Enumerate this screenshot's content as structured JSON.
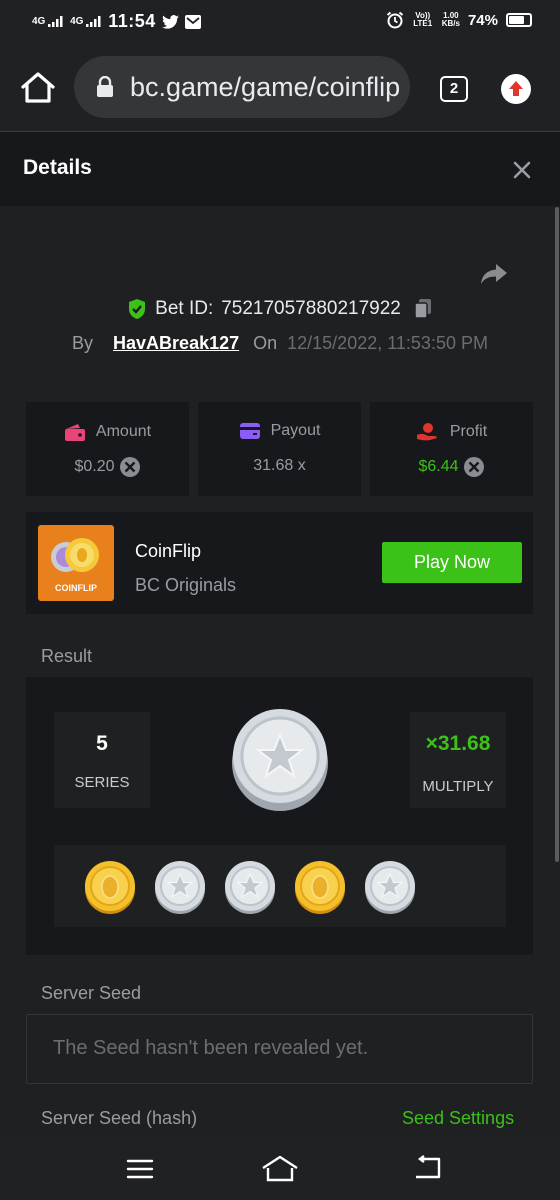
{
  "status_bar": {
    "signal1": "4G",
    "signal2": "4G",
    "time": "11:54",
    "volte": "Vo)) LTE1",
    "speed": "1.00",
    "speed_unit": "KB/s",
    "battery": "74%"
  },
  "browser": {
    "url": "bc.game/game/coinflip",
    "tab_count": "2"
  },
  "details": {
    "title": "Details"
  },
  "bet": {
    "bet_id_label": "Bet ID:",
    "bet_id": "75217057880217922",
    "by_label": "By",
    "username": "HavABreak127",
    "on_label": "On",
    "datetime": "12/15/2022, 11:53:50 PM"
  },
  "stats": [
    {
      "label": "Amount",
      "value": "$0.20",
      "icon": "wallet-icon",
      "color": "#e8447a"
    },
    {
      "label": "Payout",
      "value": "31.68 x",
      "icon": "card-icon",
      "color": "#8b5cf6"
    },
    {
      "label": "Profit",
      "value": "$6.44",
      "icon": "hand-coin-icon",
      "color": "#e0342f"
    }
  ],
  "game": {
    "name": "CoinFlip",
    "provider": "BC Originals",
    "logo_text": "COINFLIP",
    "play_label": "Play Now"
  },
  "result": {
    "title": "Result",
    "series_value": "5",
    "series_label": "SERIES",
    "multiply_value": "×31.68",
    "multiply_label": "MULTIPLY",
    "coins": [
      "gold",
      "silver",
      "silver",
      "gold",
      "silver"
    ]
  },
  "server_seed": {
    "title": "Server Seed",
    "placeholder": "The Seed hasn't been revealed yet.",
    "hash_title": "Server Seed (hash)",
    "settings_link": "Seed Settings"
  },
  "colors": {
    "accent_green": "#3bc117",
    "profit_green": "#3bc117",
    "card_bg": "#17181b",
    "page_bg": "#1f2022"
  }
}
